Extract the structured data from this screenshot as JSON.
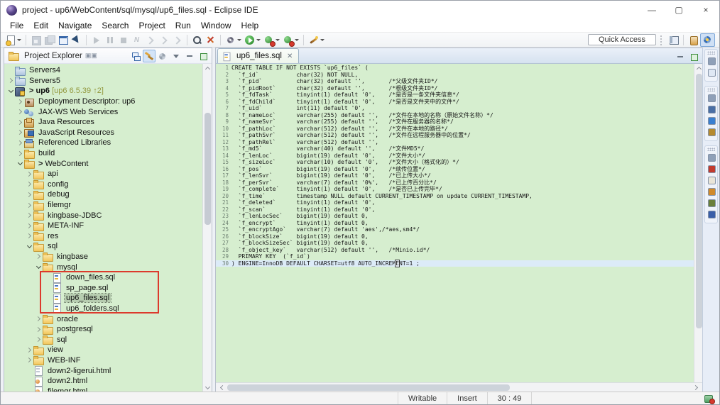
{
  "window": {
    "title": "project - up6/WebContent/sql/mysql/up6_files.sql - Eclipse IDE",
    "controls": {
      "minimize": "—",
      "maximize": "▢",
      "close": "×"
    }
  },
  "menu": {
    "items": [
      "File",
      "Edit",
      "Navigate",
      "Search",
      "Project",
      "Run",
      "Window",
      "Help"
    ]
  },
  "toolbar": {
    "quick_access_label": "Quick Access",
    "items": [
      {
        "name": "new-button",
        "shape": "new",
        "dropdown": true
      },
      {
        "name": "toolbar-separator",
        "shape": "sep"
      },
      {
        "name": "save-button",
        "shape": "save",
        "disabled": true
      },
      {
        "name": "save-all-button",
        "shape": "saveall",
        "disabled": true
      },
      {
        "name": "open-console-button",
        "shape": "window"
      },
      {
        "name": "link-selection-button",
        "shape": "cursor"
      },
      {
        "name": "toolbar-separator",
        "shape": "sep"
      },
      {
        "name": "resume-button",
        "shape": "play",
        "disabled": true
      },
      {
        "name": "suspend-button",
        "shape": "pause",
        "disabled": true
      },
      {
        "name": "terminate-button",
        "shape": "stop",
        "disabled": true
      },
      {
        "name": "disconnect-button",
        "shape": "nchar",
        "glyph": "N",
        "disabled": true
      },
      {
        "name": "step-into-button",
        "shape": "arr",
        "disabled": true
      },
      {
        "name": "step-over-button",
        "shape": "arr",
        "disabled": true
      },
      {
        "name": "step-return-button",
        "shape": "arr",
        "disabled": true
      },
      {
        "name": "toolbar-separator",
        "shape": "sep"
      },
      {
        "name": "search-button",
        "shape": "search"
      },
      {
        "name": "mark-occurrences-button",
        "shape": "hatch"
      },
      {
        "name": "toolbar-separator",
        "shape": "sep"
      },
      {
        "name": "external-tools-button",
        "shape": "gear",
        "dropdown": true
      },
      {
        "name": "run-button",
        "shape": "run",
        "dropdown": true
      },
      {
        "name": "coverage-button",
        "shape": "greenred",
        "dropdown": true
      },
      {
        "name": "profile-button",
        "shape": "greenred",
        "dropdown": true
      },
      {
        "name": "toolbar-separator",
        "shape": "sep"
      },
      {
        "name": "new-wizard-button",
        "shape": "wand",
        "dropdown": true
      }
    ],
    "perspectives": [
      {
        "name": "open-perspective-button",
        "shape": "persp"
      },
      {
        "name": "perspective-separator",
        "shape": "sep"
      },
      {
        "name": "java-perspective-button",
        "shape": "java"
      },
      {
        "name": "javaee-perspective-button",
        "shape": "jee",
        "active": true
      }
    ]
  },
  "project_explorer": {
    "title": "Project Explorer",
    "tab_marker": "▣▣",
    "header_buttons": [
      {
        "name": "collapse-all-button",
        "shape": "collapseall"
      },
      {
        "name": "link-with-editor-button",
        "shape": "linked",
        "active": true
      },
      {
        "name": "filters-button",
        "shape": "filters"
      },
      {
        "name": "view-menu-button",
        "shape": "vmenu"
      },
      {
        "name": "minimize-view-button",
        "shape": "minv"
      },
      {
        "name": "maximize-view-button",
        "shape": "maxv"
      }
    ],
    "items": [
      {
        "level": 0,
        "chev": null,
        "icon": "server",
        "label": "Servers4"
      },
      {
        "level": 0,
        "chev": "c",
        "icon": "server",
        "label": "Servers5"
      },
      {
        "level": 0,
        "chev": "e",
        "icon": "project",
        "prefix": "> ",
        "label": "up6",
        "suffix": " [up6 6.5.39 ↑2]",
        "bold": true
      },
      {
        "level": 1,
        "chev": "c",
        "icon": "dd",
        "label": "Deployment Descriptor: up6"
      },
      {
        "level": 1,
        "chev": "c",
        "icon": "jaxws",
        "label": "JAX-WS Web Services"
      },
      {
        "level": 1,
        "chev": "c",
        "icon": "javares",
        "label": "Java Resources"
      },
      {
        "level": 1,
        "chev": "c",
        "icon": "jsres",
        "label": "JavaScript Resources"
      },
      {
        "level": 1,
        "chev": "c",
        "icon": "libs",
        "label": "Referenced Libraries"
      },
      {
        "level": 1,
        "chev": "c",
        "icon": "folder",
        "label": "build"
      },
      {
        "level": 1,
        "chev": "e",
        "icon": "webfolder",
        "prefix": "> ",
        "label": "WebContent"
      },
      {
        "level": 2,
        "chev": "c",
        "icon": "folder",
        "label": "api"
      },
      {
        "level": 2,
        "chev": "c",
        "icon": "folder",
        "label": "config"
      },
      {
        "level": 2,
        "chev": "c",
        "icon": "folder",
        "label": "debug"
      },
      {
        "level": 2,
        "chev": "c",
        "icon": "folder",
        "label": "filemgr"
      },
      {
        "level": 2,
        "chev": "c",
        "icon": "folder",
        "label": "kingbase-JDBC"
      },
      {
        "level": 2,
        "chev": "c",
        "icon": "folder",
        "label": "META-INF"
      },
      {
        "level": 2,
        "chev": "c",
        "icon": "folder",
        "label": "res"
      },
      {
        "level": 2,
        "chev": "e",
        "icon": "folder",
        "label": "sql"
      },
      {
        "level": 3,
        "chev": "c",
        "icon": "folder",
        "label": "kingbase"
      },
      {
        "level": 3,
        "chev": "e",
        "icon": "folder",
        "label": "mysql"
      },
      {
        "level": 4,
        "chev": null,
        "icon": "sqlfile",
        "label": "down_files.sql",
        "boxed": true
      },
      {
        "level": 4,
        "chev": null,
        "icon": "sqlfile",
        "label": "sp_page.sql",
        "boxed": true
      },
      {
        "level": 4,
        "chev": null,
        "icon": "sqlfile",
        "label": "up6_files.sql",
        "boxed": true,
        "selected": true
      },
      {
        "level": 4,
        "chev": null,
        "icon": "sqlfile",
        "label": "up6_folders.sql",
        "boxed": true
      },
      {
        "level": 3,
        "chev": "c",
        "icon": "folder",
        "label": "oracle"
      },
      {
        "level": 3,
        "chev": "c",
        "icon": "folder",
        "label": "postgresql"
      },
      {
        "level": 3,
        "chev": "c",
        "icon": "folder",
        "label": "sql"
      },
      {
        "level": 2,
        "chev": "c",
        "icon": "folder",
        "label": "view"
      },
      {
        "level": 2,
        "chev": "c",
        "icon": "folder",
        "label": "WEB-INF"
      },
      {
        "level": 2,
        "chev": null,
        "icon": "file",
        "label": "down2-ligerui.html"
      },
      {
        "level": 2,
        "chev": null,
        "icon": "htmlfile",
        "label": "down2.html"
      },
      {
        "level": 2,
        "chev": null,
        "icon": "htmlfile",
        "label": "filemgr.html"
      }
    ]
  },
  "editor": {
    "tab": {
      "label": "up6_files.sql",
      "close": "✕"
    },
    "cursor": {
      "line": 30,
      "column": 49
    },
    "current_line": 30,
    "lines": [
      "CREATE TABLE IF NOT EXISTS `up6_files` (",
      "  `f_id`           char(32) NOT NULL,",
      "  `f_pid`          char(32) default '',       /*父级文件夹ID*/",
      "  `f_pidRoot`      char(32) default '',       /*根级文件夹ID*/",
      "  `f_fdTask`       tinyint(1) default '0',    /*是否是一条文件夹信息*/",
      "  `f_fdChild`      tinyint(1) default '0',    /*是否是文件夹中的文件*/",
      "  `f_uid`          int(11) default '0',",
      "  `f_nameLoc`      varchar(255) default '',   /*文件在本地的名称（原始文件名称）*/",
      "  `f_nameSvr`      varchar(255) default '',   /*文件在服务器的名称*/",
      "  `f_pathLoc`      varchar(512) default '',   /*文件在本地的路径*/",
      "  `f_pathSvr`      varchar(512) default '',   /*文件在远程服务器中的位置*/",
      "  `f_pathRel`      varchar(512) default '',",
      "  `f_md5`          varchar(40) default '',    /*文件MD5*/",
      "  `f_lenLoc`       bigint(19) default '0',    /*文件大小*/",
      "  `f_sizeLoc`      varchar(10) default '0',   /*文件大小（格式化的）*/",
      "  `f_pos`          bigint(19) default '0',    /*续传位置*/",
      "  `f_lenSvr`       bigint(19) default '0',    /*已上传大小*/",
      "  `f_perSvr`       varchar(7) default '0%',   /*已上传百分比*/",
      "  `f_complete`     tinyint(1) default '0',    /*是否已上传完毕*/",
      "  `f_time`         timestamp NULL default CURRENT_TIMESTAMP on update CURRENT_TIMESTAMP,",
      "  `f_deleted`      tinyint(1) default '0',",
      "  `f_scan`         tinyint(1) default '0',",
      "  `f_lenLocSec`    bigint(19) default 0,",
      "  `f_encrypt`      tinyint(1) default 0,",
      "  `f_encryptAgo`   varchar(7) default 'aes',/*aes,sm4*/",
      "  `f_blockSize`    bigint(19) default 0,",
      "  `f_blockSizeSec` bigint(19) default 0,",
      "  `f_object_key`   varchar(512) default '',   /*Minio.id*/",
      "  PRIMARY KEY  (`f_id`)",
      ") ENGINE=InnoDB DEFAULT CHARSET=utf8 AUTO_INCREMENT=1 ;"
    ]
  },
  "right_strip": {
    "groups": [
      {
        "icons": [
          {
            "name": "restore-view-icon",
            "color": "#8fa0b8"
          },
          {
            "name": "outline-view-icon",
            "color": "#dfe8f4"
          }
        ]
      },
      {
        "icons": [
          {
            "name": "restore-view-icon",
            "color": "#8fa0b8"
          },
          {
            "name": "variables-view-icon",
            "color": "#4a6fa5"
          },
          {
            "name": "breakpoints-view-icon",
            "color": "#3a7fd0"
          },
          {
            "name": "expressions-view-icon",
            "color": "#b58a2f"
          }
        ]
      },
      {
        "icons": [
          {
            "name": "restore-view-icon",
            "color": "#8fa0b8"
          },
          {
            "name": "servers-view-icon",
            "color": "#c23b2e"
          },
          {
            "name": "history-view-icon",
            "color": "#e9e5d8"
          },
          {
            "name": "snippets-view-icon",
            "color": "#d08a2a"
          },
          {
            "name": "search-view-icon",
            "color": "#6a7f3a"
          },
          {
            "name": "display-view-icon",
            "color": "#3a5fa8"
          }
        ]
      }
    ]
  },
  "status_bar": {
    "writable": "Writable",
    "mode": "Insert",
    "position": "30 : 49"
  }
}
